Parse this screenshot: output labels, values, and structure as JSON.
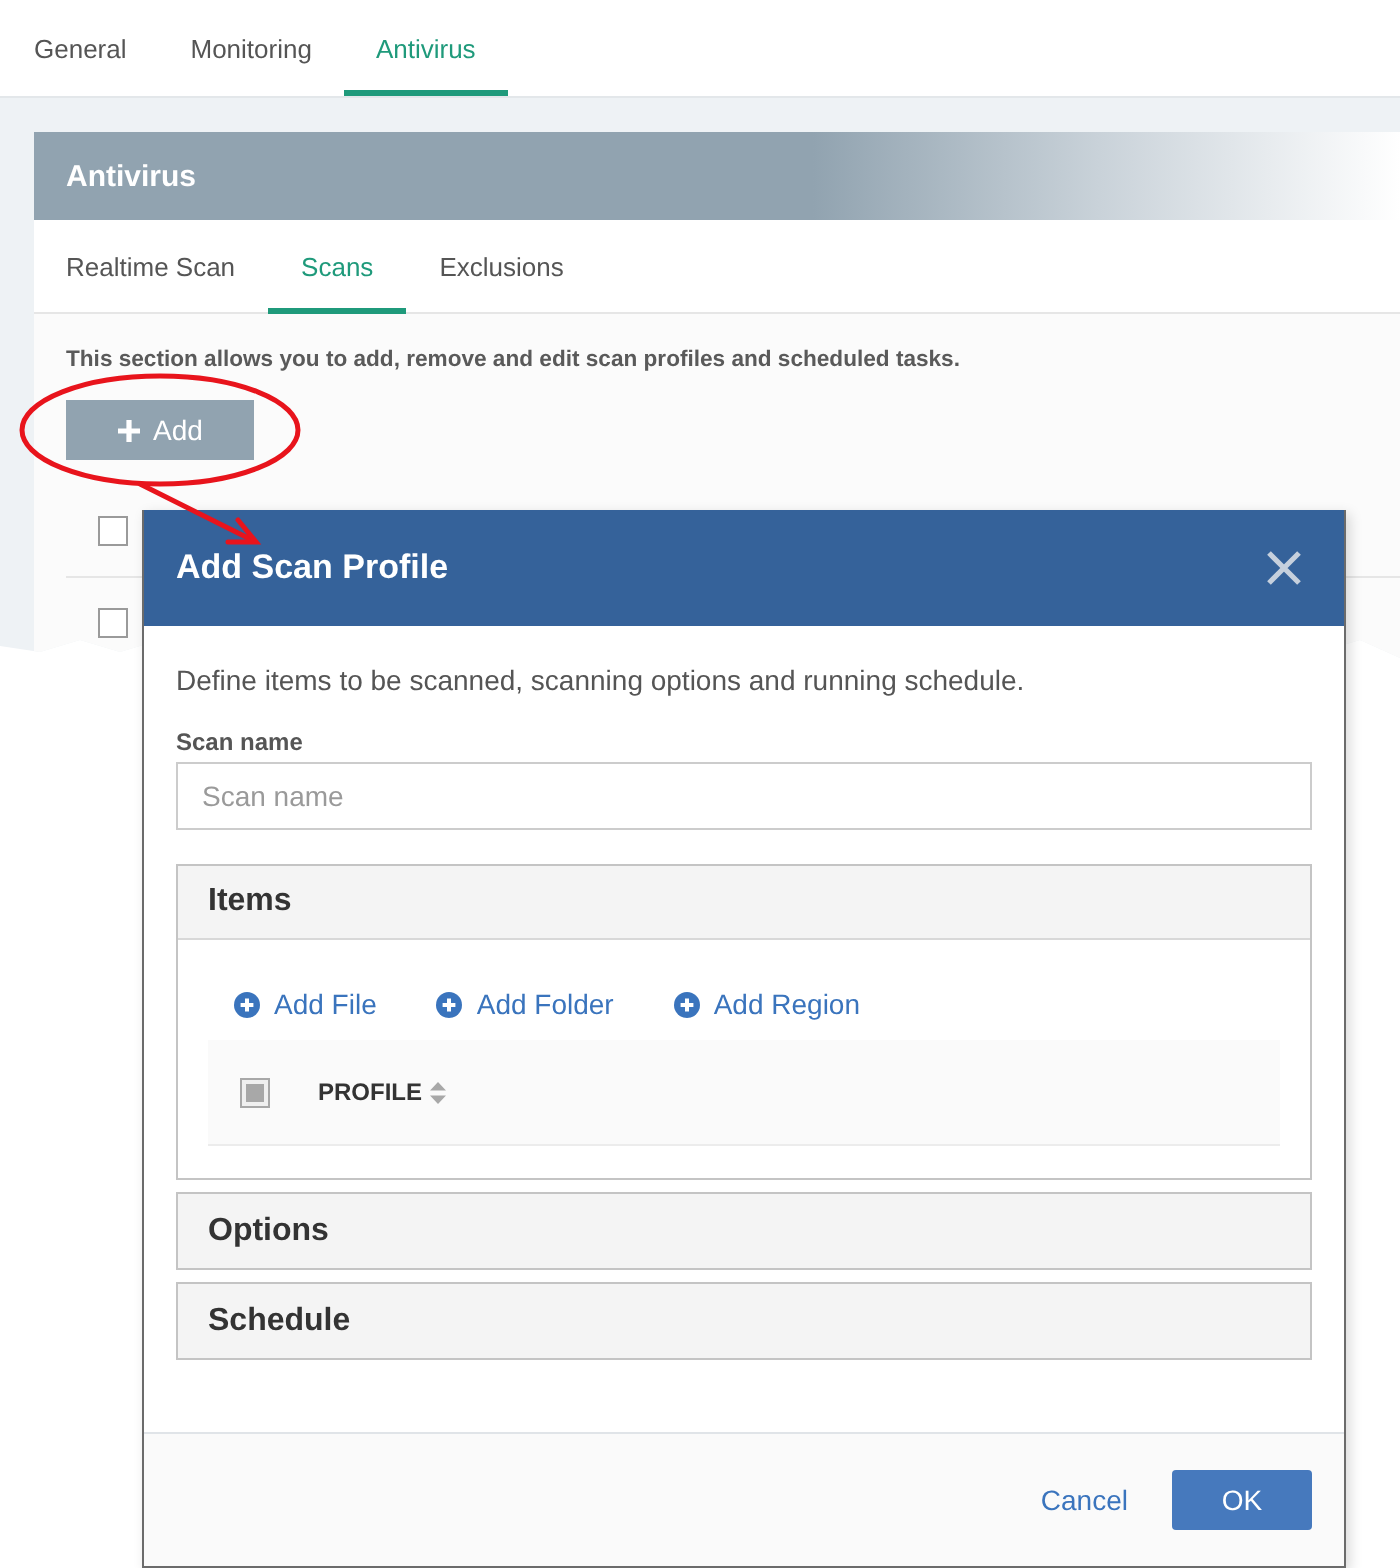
{
  "top_tabs": [
    {
      "label": "General",
      "selected": false
    },
    {
      "label": "Monitoring",
      "selected": false
    },
    {
      "label": "Antivirus",
      "selected": true
    }
  ],
  "panel": {
    "title": "Antivirus",
    "tabs": [
      {
        "label": "Realtime Scan",
        "selected": false
      },
      {
        "label": "Scans",
        "selected": true
      },
      {
        "label": "Exclusions",
        "selected": false
      }
    ],
    "description": "This section allows you to add, remove and edit scan profiles and scheduled tasks.",
    "add_button": "Add",
    "rows": [
      {
        "checked": false
      },
      {
        "checked": false
      }
    ]
  },
  "dialog": {
    "title": "Add Scan Profile",
    "description": "Define items to be scanned, scanning options and running schedule.",
    "scan_name": {
      "label": "Scan name",
      "placeholder": "Scan name"
    },
    "sections": [
      {
        "title": "Items",
        "expanded": true,
        "actions": [
          "Add File",
          "Add Folder",
          "Add Region"
        ],
        "table": {
          "select_all": {
            "disabled": true
          },
          "columns": [
            {
              "label": "PROFILE",
              "sortable": true
            }
          ]
        }
      },
      {
        "title": "Options",
        "expanded": false
      },
      {
        "title": "Schedule",
        "expanded": false
      }
    ],
    "buttons": [
      {
        "label": "Cancel",
        "kind": "link"
      },
      {
        "label": "OK",
        "kind": "primary"
      }
    ]
  }
}
